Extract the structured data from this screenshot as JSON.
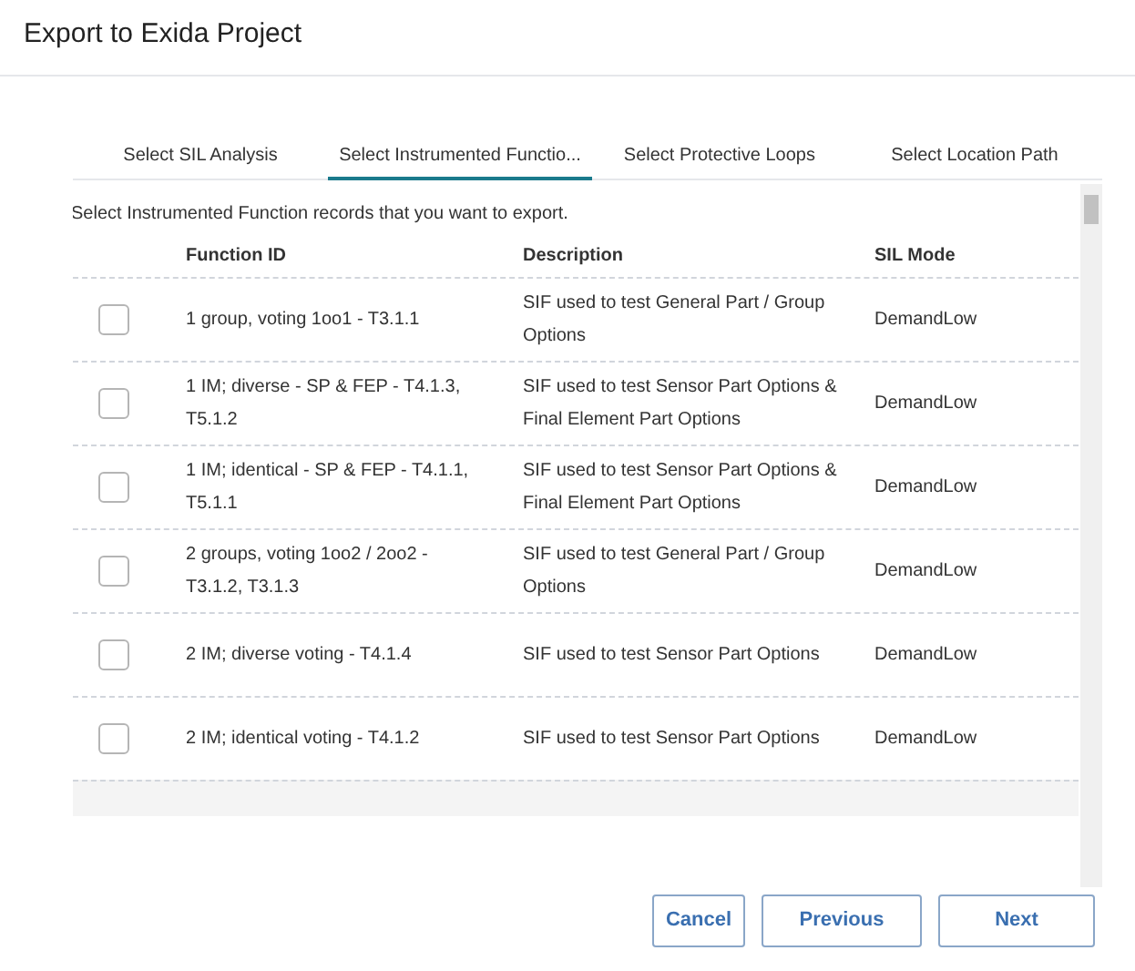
{
  "window": {
    "title": "Export to Exida Project"
  },
  "tabs": [
    {
      "label": "Select SIL Analysis",
      "selected": false
    },
    {
      "label": "Select Instrumented Functio...",
      "selected": true
    },
    {
      "label": "Select Protective Loops",
      "selected": false
    },
    {
      "label": "Select Location Path",
      "selected": false
    }
  ],
  "instructions": "Select Instrumented Function records that you want to export.",
  "table": {
    "columns": [
      "Function ID",
      "Description",
      "SIL Mode"
    ],
    "rows": [
      {
        "checked": false,
        "cells": [
          "1 group, voting 1oo1 - T3.1.1",
          "SIF used to test General Part / Group Options",
          "DemandLow"
        ]
      },
      {
        "checked": false,
        "cells": [
          "1 IM; diverse - SP & FEP - T4.1.3, T5.1.2",
          "SIF used to test Sensor Part Options & Final Element Part Options",
          "DemandLow"
        ]
      },
      {
        "checked": false,
        "cells": [
          "1 IM; identical - SP & FEP - T4.1.1, T5.1.1",
          "SIF used to test Sensor Part Options & Final Element Part Options",
          "DemandLow"
        ]
      },
      {
        "checked": false,
        "cells": [
          "2 groups, voting 1oo2 / 2oo2 - T3.1.2, T3.1.3",
          "SIF used to test General Part / Group Options",
          "DemandLow"
        ]
      },
      {
        "checked": false,
        "cells": [
          "2 IM; diverse voting - T4.1.4",
          "SIF used to test Sensor Part Options",
          "DemandLow"
        ]
      },
      {
        "checked": false,
        "cells": [
          "2 IM; identical voting - T4.1.2",
          "SIF used to test Sensor Part Options",
          "DemandLow"
        ]
      }
    ]
  },
  "buttons": [
    "Cancel",
    "Previous",
    "Next"
  ]
}
